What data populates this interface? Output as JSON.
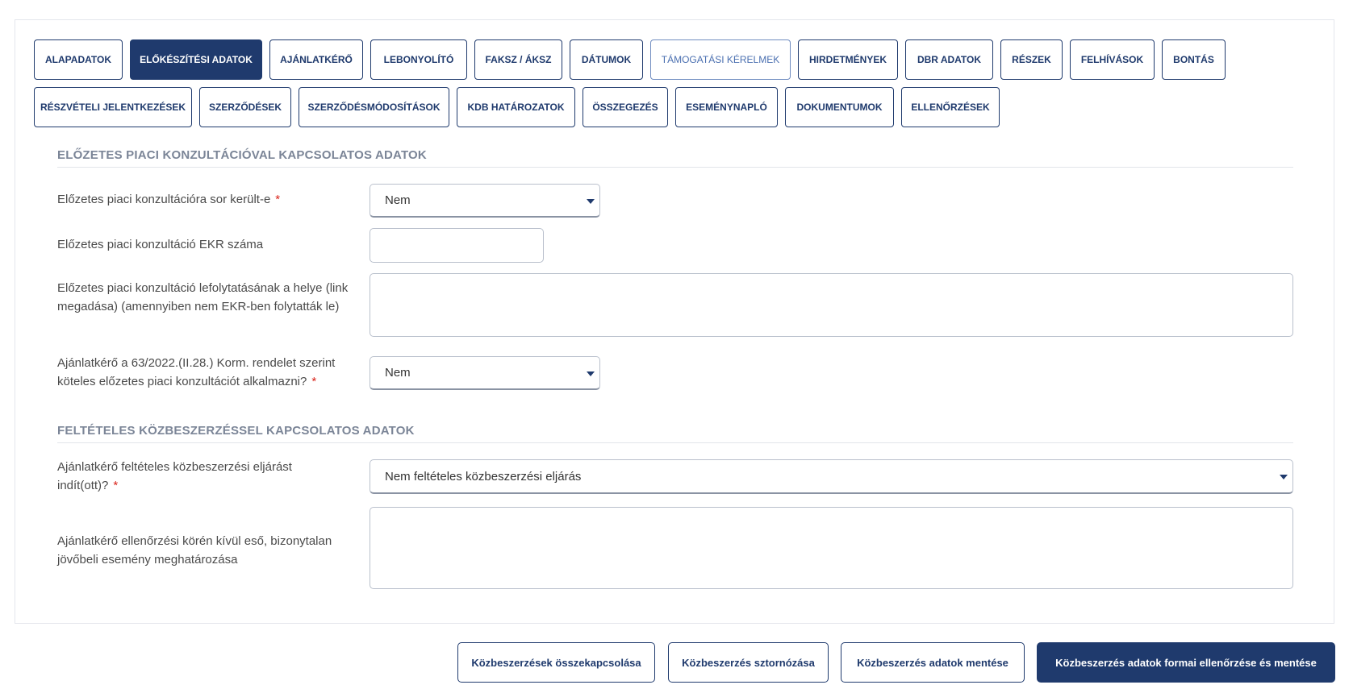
{
  "tabs": {
    "row1": [
      "ALAPADATOK",
      "ELŐKÉSZÍTÉSI ADATOK",
      "AJÁNLATKÉRŐ",
      "LEBONYOLÍTÓ",
      "FAKSZ / ÁKSZ",
      "DÁTUMOK",
      "TÁMOGATÁSI KÉRELMEK",
      "HIRDETMÉNYEK",
      "DBR ADATOK",
      "RÉSZEK",
      "FELHÍVÁSOK",
      "BONTÁS"
    ],
    "row2": [
      "RÉSZVÉTELI JELENTKEZÉSEK",
      "SZERZŐDÉSEK",
      "SZERZŐDÉSMÓDOSÍTÁSOK",
      "KDB HATÁROZATOK",
      "ÖSSZEGEZÉS",
      "ESEMÉNYNAPLÓ",
      "DOKUMENTUMOK",
      "ELLENŐRZÉSEK"
    ],
    "active": "ELŐKÉSZÍTÉSI ADATOK"
  },
  "section1": {
    "title": "ELŐZETES PIACI KONZULTÁCIÓVAL KAPCSOLATOS ADATOK",
    "field1_label": "Előzetes piaci konzultációra sor került-e",
    "field1_value": "Nem",
    "field2_label": "Előzetes piaci konzultáció EKR száma",
    "field2_value": "",
    "field3_label": "Előzetes piaci konzultáció lefolytatásának a helye (link megadása) (amennyiben nem EKR-ben folytatták le)",
    "field3_value": "",
    "field4_label": "Ajánlatkérő a 63/2022.(II.28.) Korm. rendelet szerint köteles előzetes piaci konzultációt alkalmazni?",
    "field4_value": "Nem"
  },
  "section2": {
    "title": "FELTÉTELES KÖZBESZERZÉSSEL KAPCSOLATOS ADATOK",
    "field1_label": "Ajánlatkérő feltételes közbeszerzési eljárást indít(ott)?",
    "field1_value": "Nem feltételes közbeszerzési eljárás",
    "field2_label": "Ajánlatkérő ellenőrzési körén kívül eső, bizonytalan jövőbeli esemény meghatározása",
    "field2_value": ""
  },
  "required_mark": "*",
  "buttons": {
    "link": "Közbeszerzések összekapcsolása",
    "cancel": "Közbeszerzés sztornózása",
    "save": "Közbeszerzés adatok mentése",
    "check_save": "Közbeszerzés adatok formai ellenőrzése és mentése"
  }
}
